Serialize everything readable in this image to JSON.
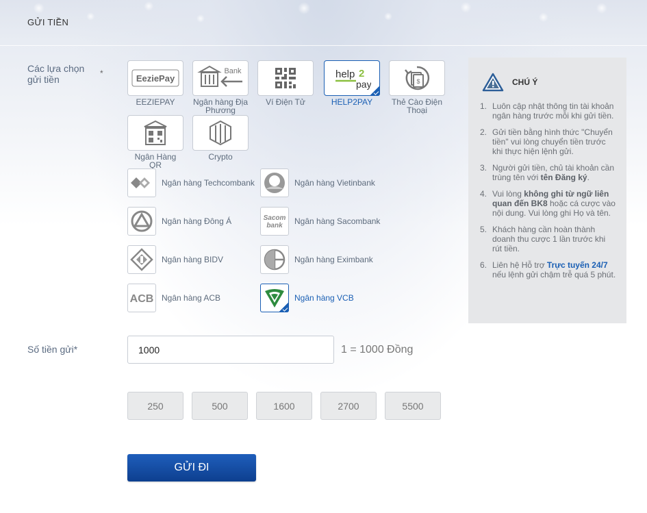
{
  "page": {
    "title": "GỬI TIỀN"
  },
  "deposit_options": {
    "label": "Các lựa chọn gửi tiền",
    "required_mark": "*"
  },
  "methods": [
    {
      "label": "EEZIEPAY",
      "logo_text": "EeziePay",
      "selected": false
    },
    {
      "label": "Ngân hàng Địa Phương",
      "logo_text": "Bank",
      "selected": false
    },
    {
      "label": "Ví Điện Tử",
      "selected": false
    },
    {
      "label": "HELP2PAY",
      "logo_text": "help2pay",
      "selected": true
    },
    {
      "label": "Thẻ Cào Điện Thoại",
      "selected": false
    },
    {
      "label": "Ngân Hàng QR",
      "selected": false
    },
    {
      "label": "Crypto",
      "selected": false
    }
  ],
  "banks": [
    {
      "name": "Ngân hàng Techcombank",
      "selected": false
    },
    {
      "name": "Ngân hàng Vietinbank",
      "selected": false
    },
    {
      "name": "Ngân hàng Đông Á",
      "selected": false
    },
    {
      "name": "Ngân hàng Sacombank",
      "logo_text": "Sacom bank",
      "selected": false
    },
    {
      "name": "Ngân hàng BIDV",
      "selected": false
    },
    {
      "name": "Ngân hàng Eximbank",
      "selected": false
    },
    {
      "name": "Ngân hàng ACB",
      "logo_text": "ACB",
      "selected": false
    },
    {
      "name": "Ngân hàng VCB",
      "selected": true
    }
  ],
  "notice": {
    "title": "CHÚ Ý",
    "items": [
      {
        "num": "1.",
        "text": "Luôn cập nhật thông tin tài khoản ngân hàng trước mỗi khi gửi tiền."
      },
      {
        "num": "2.",
        "text": "Gửi tiền bằng hình thức \"Chuyển tiền\" vui lòng chuyển tiền trước khi thực hiện lệnh gửi."
      },
      {
        "num": "3.",
        "pre": "Người gửi tiền, chủ tài khoản cần trùng tên với ",
        "bold": "tên Đăng ký",
        "post": "."
      },
      {
        "num": "4.",
        "pre": "Vui lòng ",
        "bold": "không ghi từ ngữ liên quan đến BK8",
        "post": " hoặc cá cược vào nội dung. Vui lòng ghi Họ và tên."
      },
      {
        "num": "5.",
        "text": "Khách hàng cần hoàn thành doanh thu cược 1 lần trước khi rút tiền."
      },
      {
        "num": "6.",
        "pre": "Liên hệ Hỗ trợ ",
        "link": "Trực tuyến 24/7",
        "post": " nếu lệnh gửi chậm trễ quá 5 phút."
      }
    ]
  },
  "amount": {
    "label": "Số tiền gửi*",
    "value": "1000",
    "rate": "1 = 1000 Đồng"
  },
  "quick_amounts": [
    "250",
    "500",
    "1600",
    "2700",
    "5500"
  ],
  "submit": {
    "label": "GỬI ĐI"
  },
  "colors": {
    "accent": "#1a5fb4",
    "button": "#0d3f8f",
    "notice_bg": "#e6e7e9"
  }
}
